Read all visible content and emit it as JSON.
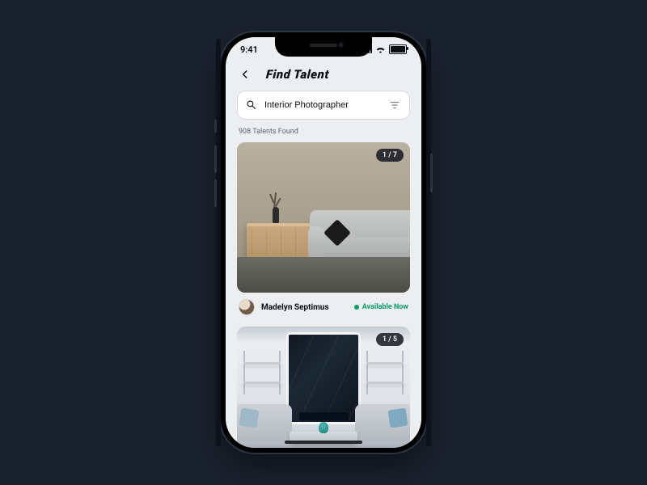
{
  "status": {
    "time": "9:41"
  },
  "header": {
    "title": "Find Talent"
  },
  "search": {
    "value": "Interior Photographer"
  },
  "results": {
    "count_label": "908 Talents Found"
  },
  "cards": [
    {
      "pager": "1 / 7",
      "user": {
        "name": "Madelyn Septimus",
        "availability": "Available Now"
      }
    },
    {
      "pager": "1 / 5"
    }
  ]
}
